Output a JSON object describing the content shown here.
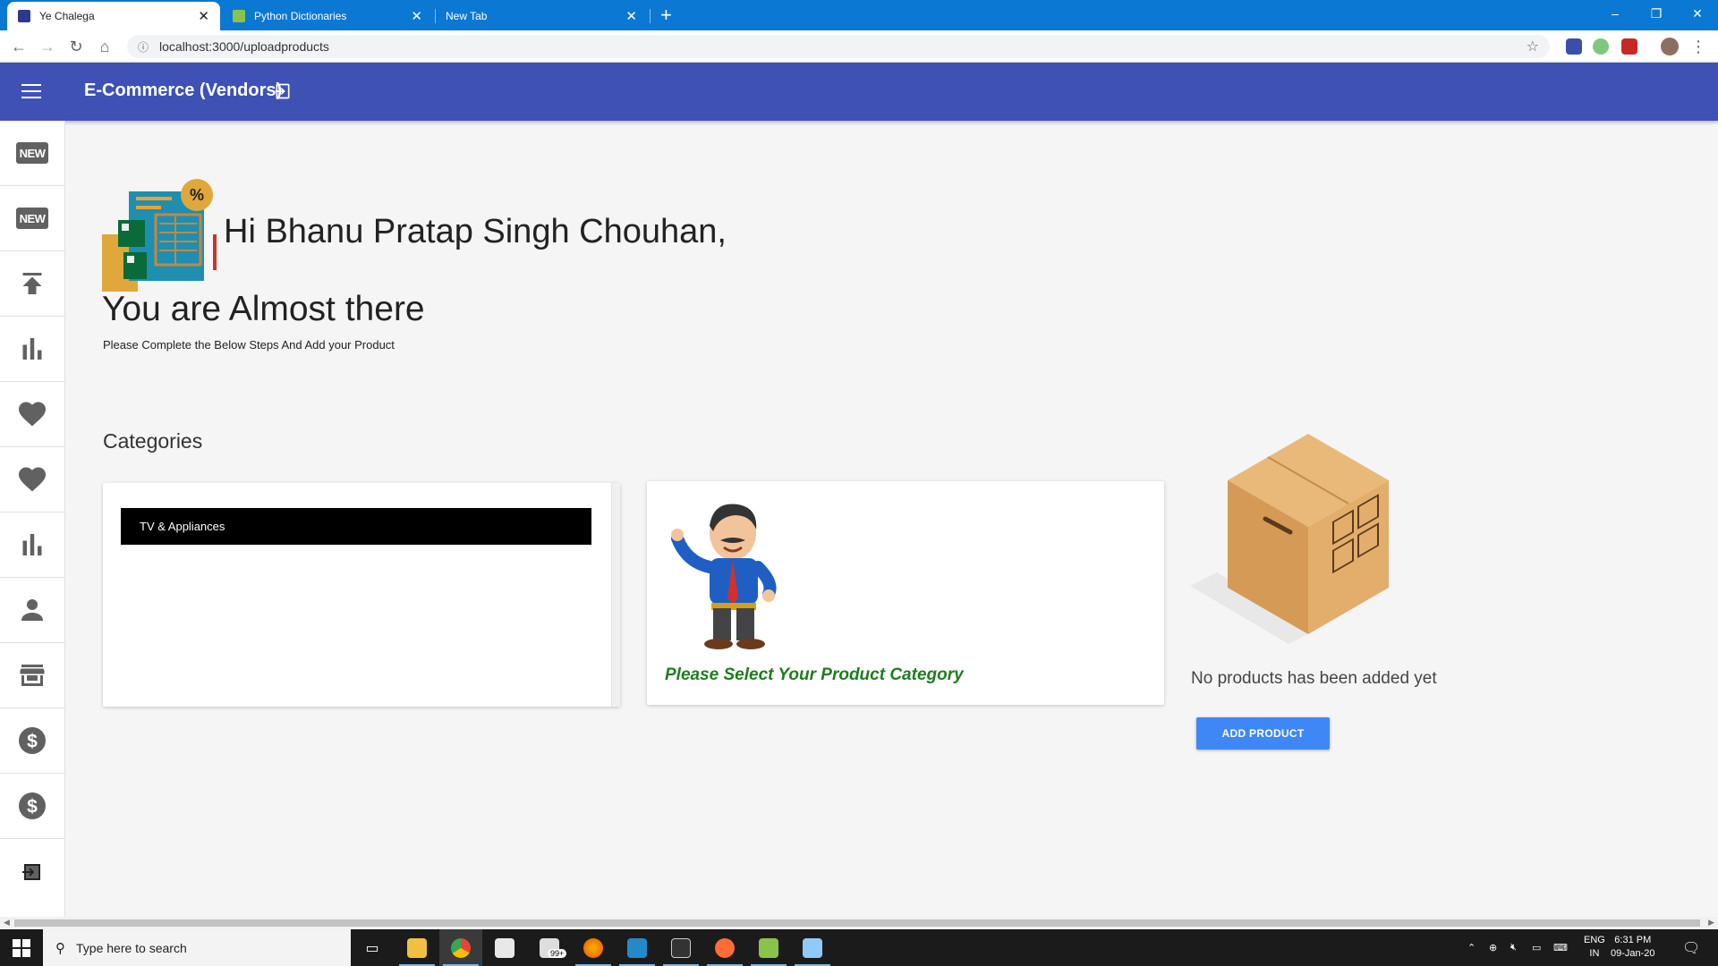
{
  "browser": {
    "tabs": [
      {
        "label": "Ye Chalega",
        "active": true,
        "favicon_color": "#2d3a8c"
      },
      {
        "label": "Python Dictionaries",
        "active": false,
        "favicon_color": "#4caf50"
      },
      {
        "label": "New Tab",
        "active": false,
        "favicon_color": ""
      }
    ],
    "new_tab_label": "+",
    "window_controls": {
      "minimize": "–",
      "maximize": "❐",
      "close": "✕"
    },
    "url": "localhost:3000/uploadproducts",
    "info_icon": "ⓘ"
  },
  "appbar": {
    "title": "E-Commerce (Vendors)",
    "color": "#3f51b5"
  },
  "sidebar": {
    "items": [
      {
        "icon": "new-badge-icon",
        "badge": "NEW"
      },
      {
        "icon": "new-badge-icon",
        "badge": "NEW"
      },
      {
        "icon": "upload-icon"
      },
      {
        "icon": "bar-chart-icon"
      },
      {
        "icon": "heart-icon"
      },
      {
        "icon": "heart-icon"
      },
      {
        "icon": "bar-chart-icon"
      },
      {
        "icon": "person-icon"
      },
      {
        "icon": "store-icon"
      },
      {
        "icon": "dollar-icon"
      },
      {
        "icon": "dollar-icon"
      },
      {
        "icon": "logout-icon"
      }
    ]
  },
  "main": {
    "greeting": "Hi Bhanu Pratap Singh Chouhan,",
    "subheading": "You are Almost there",
    "note": "Please Complete the Below Steps And Add your Product",
    "categories_title": "Categories",
    "categories": [
      "TV & Appliances"
    ],
    "select_message": "Please Select Your Product Category",
    "select_message_color": "#1e7d1e",
    "empty_message": "No products has been added yet",
    "add_button": "ADD PRODUCT",
    "add_button_color": "#3f87f5"
  },
  "taskbar": {
    "search_placeholder": "Type here to search",
    "apps": [
      "task-view",
      "file-explorer",
      "chrome",
      "store",
      "mail",
      "firefox",
      "vscode",
      "terminal",
      "postman",
      "notepad",
      "other"
    ],
    "mail_badge": "99+",
    "lang": {
      "line1": "ENG",
      "line2": "IN"
    },
    "time": "6:31 PM",
    "date": "09-Jan-20"
  }
}
